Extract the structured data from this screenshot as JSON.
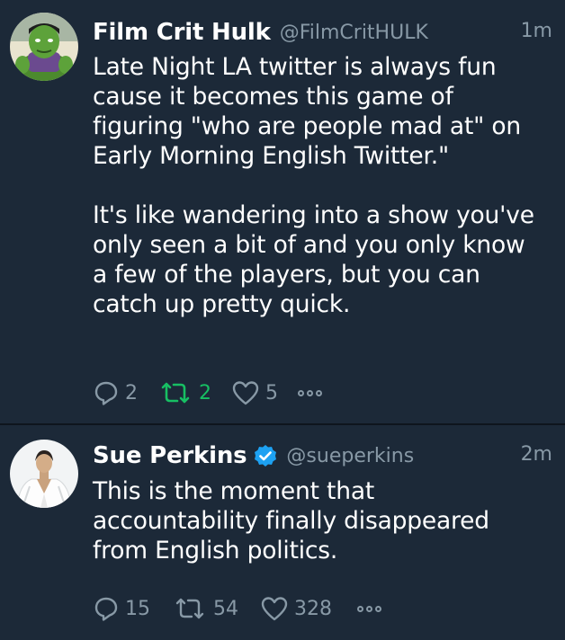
{
  "colors": {
    "background": "#1c2938",
    "divider": "#0e151d",
    "text": "#ffffff",
    "muted": "#8899a6",
    "retweet_active": "#17bf63",
    "verified": "#1da1f2"
  },
  "tweets": [
    {
      "name": "Film Crit Hulk",
      "handle": "@FilmCritHULK",
      "time": "1m",
      "verified": false,
      "avatar_icon": "hulk-avatar",
      "text": "Late Night LA twitter is always fun\ncause it becomes this game of\nfiguring \"who are people mad at\" on\nEarly Morning English Twitter.\"\n\nIt's like wandering into a show you've\nonly seen a bit of and you only know\na few of the players, but you can\ncatch up pretty quick.",
      "replies": "2",
      "retweets": "2",
      "retweeted": true,
      "likes": "5"
    },
    {
      "name": "Sue Perkins",
      "handle": "@sueperkins",
      "time": "2m",
      "verified": true,
      "avatar_icon": "woman-white-jacket-avatar",
      "text": "This is the moment that\naccountability finally disappeared\nfrom English politics.",
      "replies": "15",
      "retweets": "54",
      "retweeted": false,
      "likes": "328"
    }
  ]
}
